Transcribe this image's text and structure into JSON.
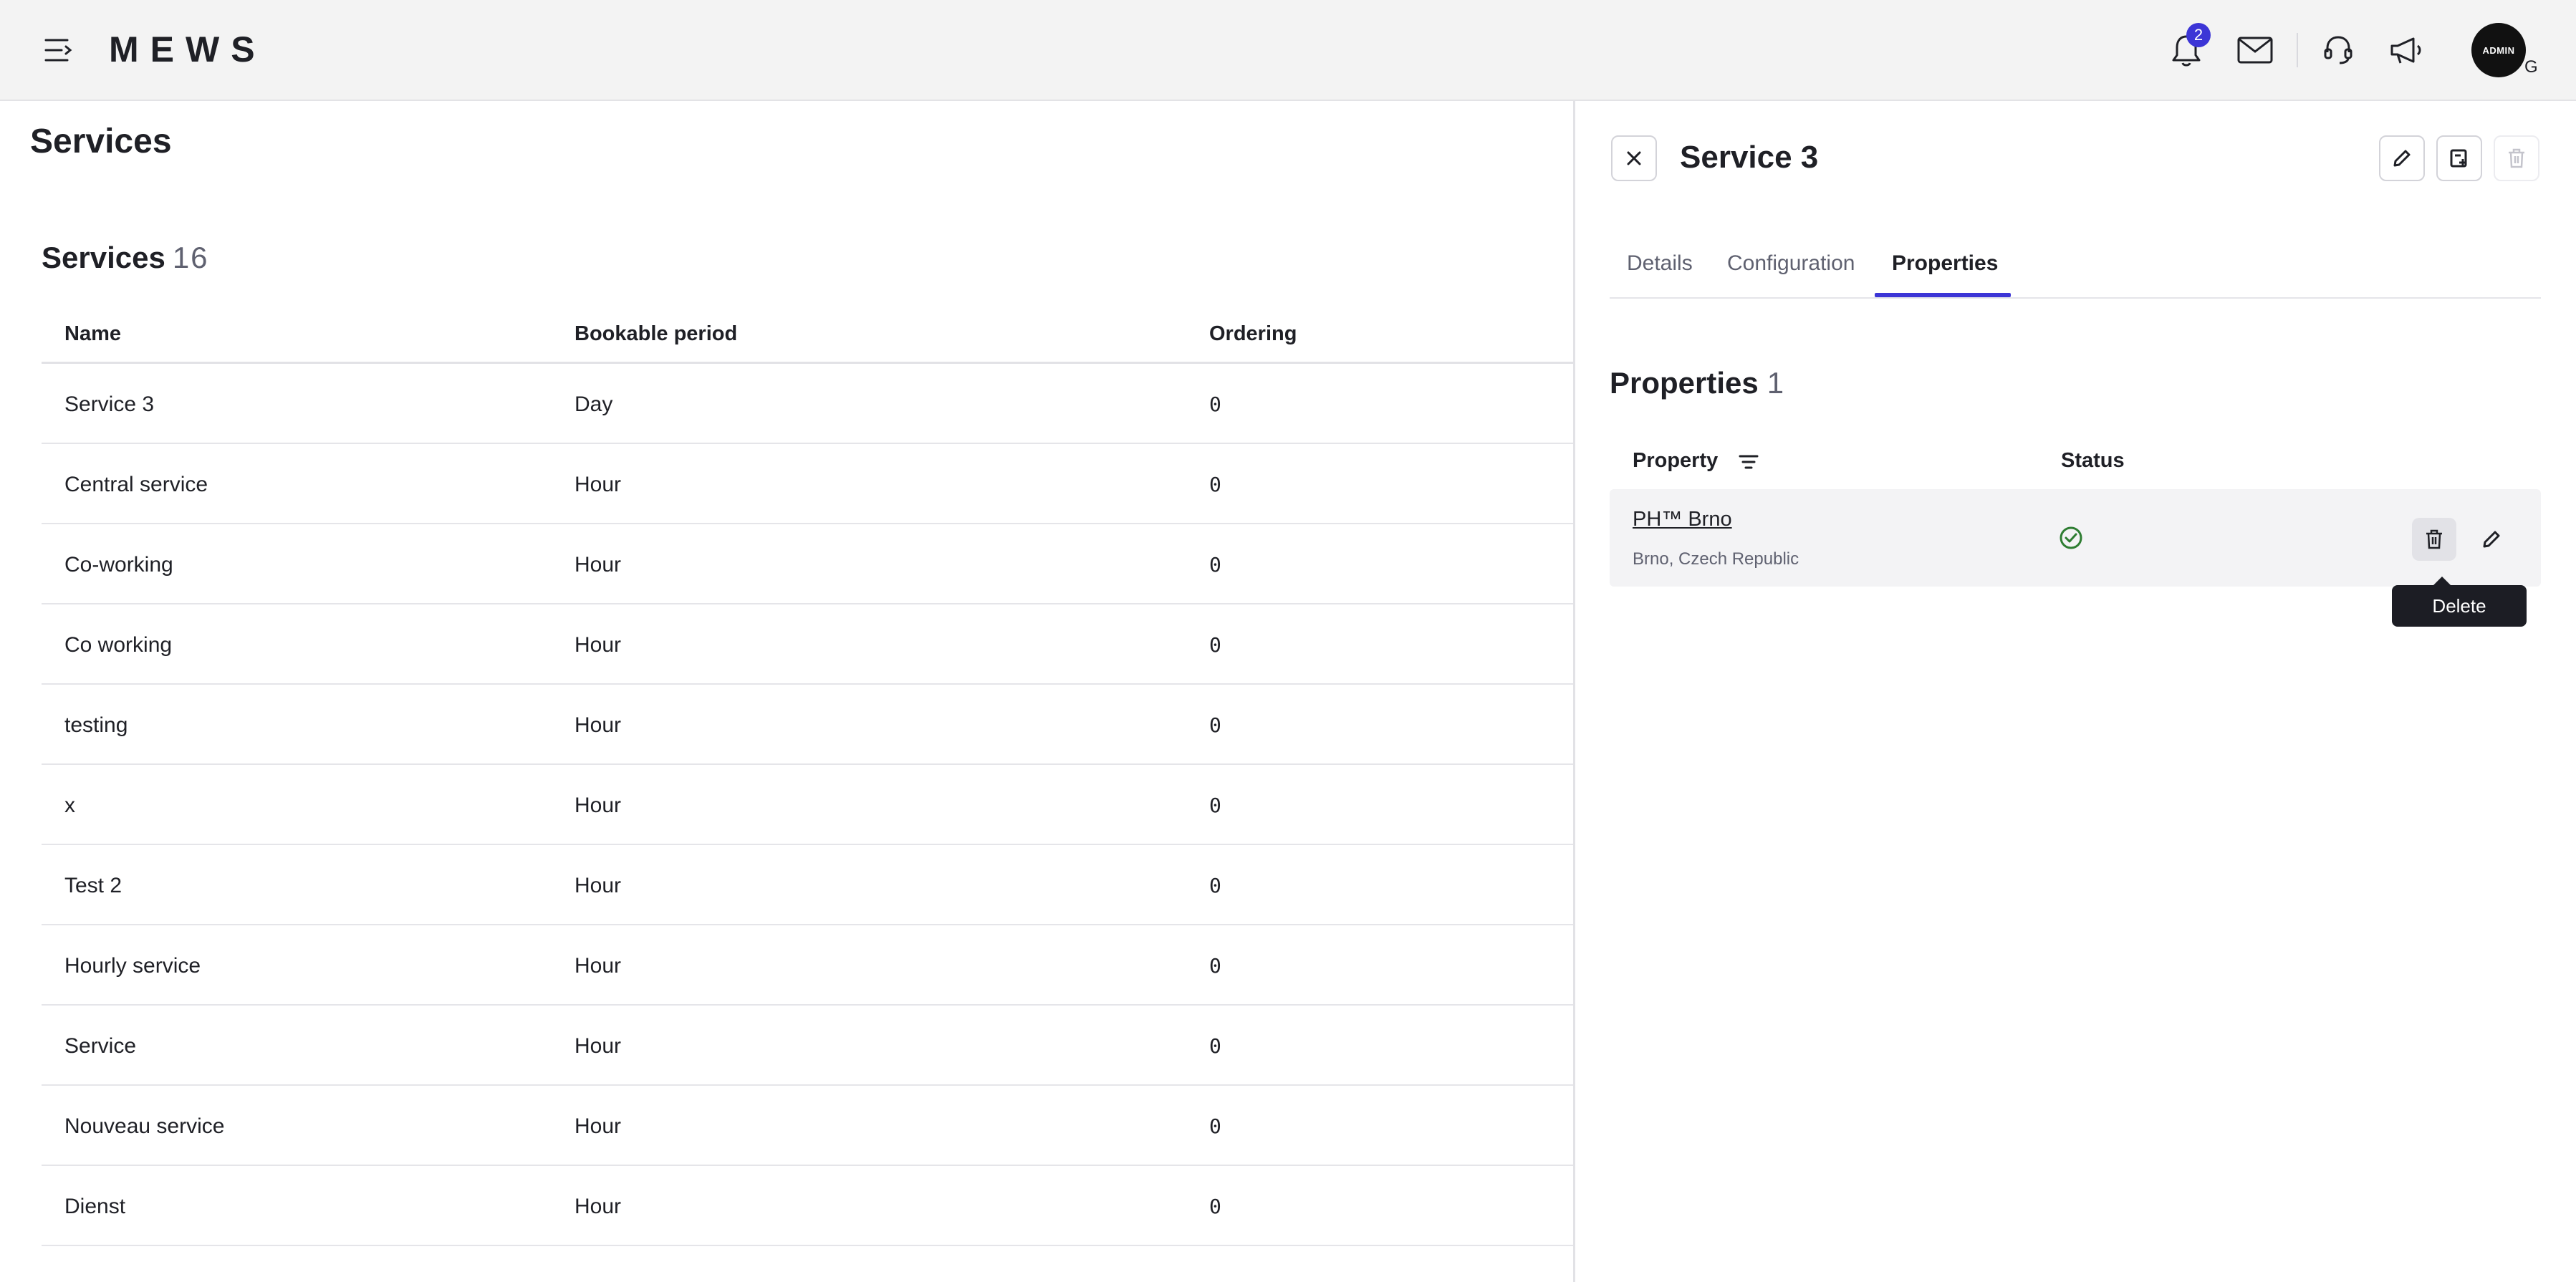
{
  "header": {
    "logo_text": "MEWS",
    "notification_count": "2",
    "avatar_label": "ADMIN",
    "avatar_letter": "G",
    "icons": [
      "menu-icon",
      "bell-icon",
      "mail-icon",
      "headset-icon",
      "megaphone-icon"
    ]
  },
  "page": {
    "title": "Services"
  },
  "services": {
    "title": "Services",
    "count": "16",
    "columns": [
      "Name",
      "Bookable period",
      "Ordering"
    ],
    "rows": [
      [
        "Service 3",
        "Day",
        "0"
      ],
      [
        "Central service",
        "Hour",
        "0"
      ],
      [
        "Co-working",
        "Hour",
        "0"
      ],
      [
        "Co working",
        "Hour",
        "0"
      ],
      [
        "testing",
        "Hour",
        "0"
      ],
      [
        "x",
        "Hour",
        "0"
      ],
      [
        "Test 2",
        "Hour",
        "0"
      ],
      [
        "Hourly service",
        "Hour",
        "0"
      ],
      [
        "Service",
        "Hour",
        "0"
      ],
      [
        "Nouveau service",
        "Hour",
        "0"
      ],
      [
        "Dienst",
        "Hour",
        "0"
      ]
    ]
  },
  "panel": {
    "title": "Service 3",
    "tabs": [
      "Details",
      "Configuration",
      "Properties"
    ],
    "active_tab": "Properties",
    "properties": {
      "title": "Properties",
      "count": "1",
      "columns": {
        "property": "Property",
        "status": "Status"
      },
      "items": [
        {
          "name": "PH™ Brno",
          "location": "Brno, Czech Republic",
          "status": "active"
        }
      ]
    },
    "tooltip": "Delete"
  },
  "colors": {
    "accent": "#3c35d6",
    "success": "#2e7d32",
    "topbar": "#f3f3f3"
  }
}
